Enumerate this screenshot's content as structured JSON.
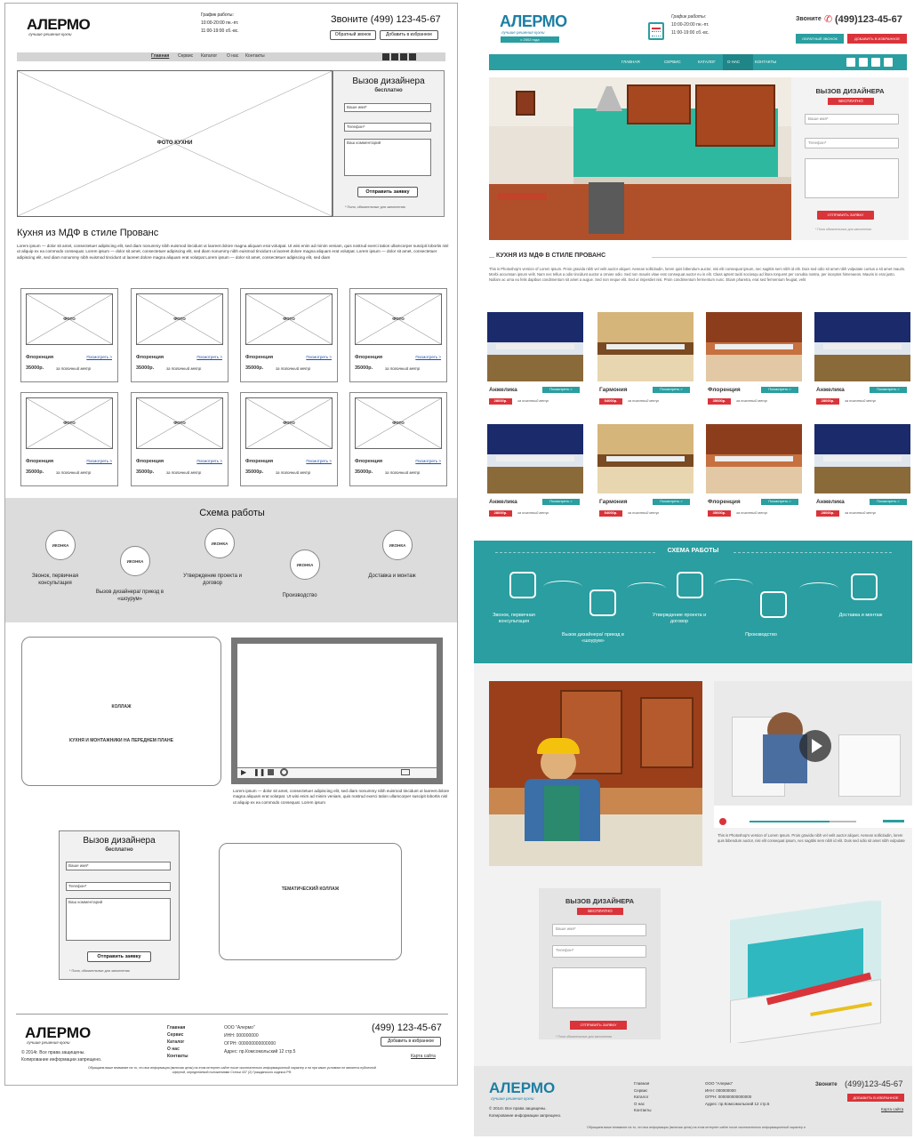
{
  "wireframe": {
    "header": {
      "logo": "АЛЕРМО",
      "tagline": "лучшие решения кухни",
      "schedule_label": "График работы:",
      "schedule_1": "10:00-20:00 пн.-пт.",
      "schedule_2": "11:00-19:00 сб.-вс.",
      "phone": "Звоните (499) 123-45-67",
      "callback_btn": "Обратный звонок",
      "fav_btn": "Добавить в избранное"
    },
    "nav": [
      "Главная",
      "Сервис",
      "Каталог",
      "О нас",
      "Контакты"
    ],
    "hero": {
      "photo_label": "ФОТО КУХНИ",
      "form_title": "Вызов дизайнера",
      "form_sub": "бесплатно",
      "name_ph": "Ваше имя*",
      "phone_ph": "Телефон*",
      "comment_ph": "Ваш комментарий",
      "submit": "Отправить заявку",
      "note": "* Поля, обязательные для заполнения"
    },
    "section_title": "Кухня из МДФ в стиле Прованс",
    "intro": "Lorem ipsum — dolor sit amet, consectetuer adipiscing elit, sed diam nonummy nibh euismod tincidunt ut laoreet dolore magna aliquam erat volutpat. Ut wisi enim ad minim veniam, quis nostrud exerci tation ullamcorper suscipit lobortis nisl ut aliquip ex ea commodo consequat. Lorem ipsum — dolor sit amet, consectetuer adipiscing elit, sed diam nonummy nibh euismod tincidunt ut laoreet dolore magna aliquam erat volutpat. Lorem ipsum — dolor sit amet, consectetuer adipiscing elit, sed diam nonummy nibh euismod tincidunt ut laoreet dolore magna aliquam erat volutpat Lorem ipsum — dolor sit amet, consectetuer adipiscing elit, sed diam",
    "card": {
      "photo": "ФОТО",
      "name": "Флоренция",
      "link": "Посмотреть >",
      "price": "35000р.",
      "unit": "за погонный метр"
    },
    "scheme_title": "Схема работы",
    "icon_label": "ИКОНКА",
    "steps": [
      "Звонок, первичная консультация",
      "Вызов дизайнера/ приезд в «шоурум»",
      "Утверждение проекта и договор",
      "Производство",
      "Доставка и монтаж"
    ],
    "collage_label": "КОЛЛАЖ",
    "collage_sub": "КУХНЯ И МОНТАЖНИКИ НА ПЕРЕДНЕМ ПЛАНЕ",
    "video_text": "Lorem ipsum — dolor sit amet, consectetuer adipiscing elit, sed diam nonummy nibh euismod tincidunt ut laoreet dolore magna aliquam erat volutpat. Ut wisi enim ad minim veniam, quis nostrud exerci tation ullamcorper suscipit lobortis nisl ut aliquip ex ea commodo consequat. Lorem ipsum",
    "thematic_label": "ТЕМАТИЧЕСКИЙ КОЛЛАЖ",
    "footer": {
      "logo": "АЛЕРМО",
      "tagline": "лучшие решения кухни",
      "copy": "© 2014г. Все права защищены.",
      "copy2": "Копирование информации запрещено.",
      "links": [
        "Главная",
        "Сервис",
        "Каталог",
        "О нас",
        "Контакты"
      ],
      "company": "ООО \"Алермо\"",
      "inn": "ИНН: 000000000",
      "ogrn": "ОГРН: 000000000000000",
      "address": "Адрес: пр.Комсомольский 12 стр.5",
      "phone": "(499) 123-45-67",
      "fav_btn": "Добавить в избранное",
      "sitemap": "Карта сайта",
      "disclaimer": "Обращаем ваше внимание на то, что вся информация (включая цены) на этом интернет-сайте носит исключительно информационный характер и ни при каких условиях не является публичной офертой, определяемой положениями Статьи 437 (2) Гражданского кодекса РФ."
    }
  },
  "mockup": {
    "header": {
      "logo": "АЛЕРМО",
      "tagline": "лучшие решения кухни",
      "since": "с 2002 года",
      "schedule_label": "График работы:",
      "schedule_1": "10:00-20:00 пн.-пт.",
      "schedule_2": "11:00-19:00 сб.-вс.",
      "call_label": "Звоните",
      "phone": "(499)123-45-67",
      "callback_btn": "ОБРАТНЫЙ ЗВОНОК",
      "fav_btn": "ДОБАВИТЬ В ИЗБРАННОЕ"
    },
    "nav": [
      "ГЛАВНАЯ",
      "СЕРВИС",
      "КАТАЛОГ",
      "О НАС",
      "КОНТАКТЫ"
    ],
    "form": {
      "title": "ВЫЗОВ ДИЗАЙНЕРА",
      "sub": "БЕСПЛАТНО",
      "name_ph": "Ваше имя*",
      "phone_ph": "Телефон*",
      "submit": "ОТПРАВИТЬ ЗАЯВКУ",
      "note": "* Поля обязательные для заполнения"
    },
    "section_title": "КУХНЯ ИЗ МДФ В СТИЛЕ ПРОВАНС",
    "intro": "This is Photoshop's version of Lorem Ipsum. Proin gravida nibh vel velit auctor aliquet. Aenean sollicitudin, lorem quis bibendum auctor, nisi elit consequat ipsum, nec sagittis sem nibh id elit. Duis sed odio sit amet nibh vulputate cursus a sit amet mauris. Morbi accumsan ipsum velit. Nam nec tellus a odio tincidunt auctor a ornare odio. Sed non mauris vitae erat consequat auctor eu in elit. Class aptent taciti sociosqu ad litora torquent per conubia nostra, per inceptos himenaeos. Mauris in erat justo. Nullam ac urna eu felis dapibus condimentum sit amet a augue. Sed non neque elit. Sed ut imperdiet nisi. Proin condimentum fermentum nunc. Etiam pharetra, erat sed fermentum feugiat, velit",
    "cards": [
      {
        "name": "Анжелика",
        "price": "28000р."
      },
      {
        "name": "Гармония",
        "price": "54000р."
      },
      {
        "name": "Флоренция",
        "price": "35000р."
      },
      {
        "name": "Анжелика",
        "price": "28000р."
      },
      {
        "name": "Анжелика",
        "price": "28000р."
      },
      {
        "name": "Гармония",
        "price": "54000р."
      },
      {
        "name": "Флоренция",
        "price": "35000р."
      },
      {
        "name": "Анжелика",
        "price": "28000р."
      }
    ],
    "card_link": "Посмотреть >",
    "card_unit": "за погонный метр",
    "scheme_title": "СХЕМА РАБОТЫ",
    "steps": [
      "Звонок, первичная консультация",
      "Вызов дизайнера/ приезд в «шоурум»",
      "Утверждение проекта и договор",
      "Производство",
      "Доставка и монтаж"
    ],
    "video_text": "This is Photoshop's version of Lorem Ipsum. Proin gravida nibh vel velit auctor aliquet. Aenean sollicitudin, lorem quis bibendum auctor, nisi elit consequat ipsum, nec sagittis sem nibh id elit. Duis sed odio sit amet nibh vulputate",
    "footer": {
      "logo": "АЛЕРМО",
      "tagline": "лучшие решения кухни",
      "copy": "© 2014г. Все права защищены.",
      "copy2": "Копирование информации запрещено.",
      "links": [
        "Главная",
        "Сервис",
        "Каталог",
        "О нас",
        "Контакты"
      ],
      "company": "ООО \"Алермо\"",
      "inn": "ИНН: 000000000",
      "ogrn": "ОГРН: 000000000000000",
      "address": "Адрес: пр.Комсомольский 12 стр.5",
      "call_label": "Звоните",
      "phone": "(499)123-45-67",
      "fav_btn": "ДОБАВИТЬ В ИЗБРАННОЕ",
      "sitemap": "Карта сайта",
      "disclaimer": "Обращаем ваше внимание на то, что вся информация (включая цены) на этом интернет-сайте носит исключительно информационный характер и"
    }
  },
  "colors": {
    "teal": "#2a9ea0",
    "teal_dark": "#1f8587",
    "red": "#d9343a",
    "logo_blue": "#1d7ea3"
  }
}
